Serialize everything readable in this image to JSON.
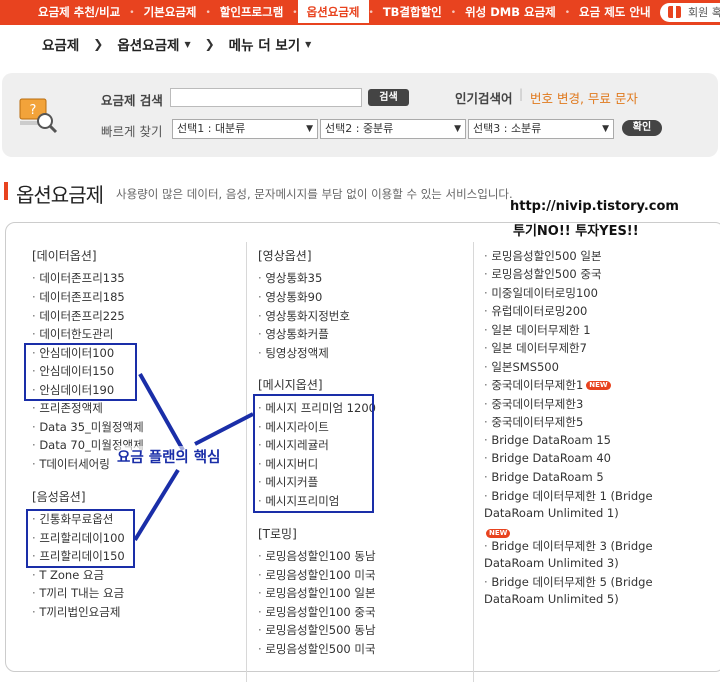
{
  "topnav": {
    "items": [
      "요금제 추천/비교",
      "기본요금제",
      "할인프로그램",
      "옵션요금제",
      "TB결합할인",
      "위성 DMB 요금제",
      "요금 제도 안내"
    ],
    "active_index": 3,
    "member_label": "회원 혹시"
  },
  "breadcrumb": {
    "items": [
      "요금제",
      "옵션요금제",
      "메뉴 더 보기"
    ]
  },
  "search": {
    "label": "요금제 검색",
    "button": "검색",
    "popular_label": "인기검색어",
    "popular_terms": "번호 변경, 무료 문자",
    "quick_label": "빠르게 찾기",
    "select1": "선택1 : 대분류",
    "select2": "선택2 : 중분류",
    "select3": "선택3 : 소분류",
    "confirm_button": "확인"
  },
  "section": {
    "title": "옵션요금제",
    "description": "사용량이 많은 데이터, 음성, 문자메시지를 부담 없이 이용할 수 있는 서비스입니다."
  },
  "overlay": {
    "url": "http://nivip.tistory.com",
    "note": "투기NO!! 투자YES!!",
    "annotation": "요금 플랜의 핵심"
  },
  "columns": {
    "data_options": {
      "title": "[데이터옵션]",
      "items": [
        "데이터존프리135",
        "데이터존프리185",
        "데이터존프리225",
        "데이터한도관리",
        "안심데이터100",
        "안심데이터150",
        "안심데이터190",
        "프리존정액제",
        "Data 35_미월정액제",
        "Data 70_미월정액제",
        "T데이터세어링"
      ]
    },
    "voice_options": {
      "title": "[음성옵션]",
      "items": [
        "긴통화무료옵션",
        "프리할리데이100",
        "프리할리데이150",
        "T Zone 요금",
        "T끼리 T내는 요금",
        "T끼리법인요금제"
      ]
    },
    "video_options": {
      "title": "[영상옵션]",
      "items": [
        "영상통화35",
        "영상통화90",
        "영상통화지정번호",
        "영상통화커플",
        "팅영상정액제"
      ]
    },
    "message_options": {
      "title": "[메시지옵션]",
      "items": [
        "메시지 프리미엄 1200",
        "메시지라이트",
        "메시지레귤러",
        "메시지버디",
        "메시지커플",
        "메시지프리미엄"
      ]
    },
    "roaming": {
      "title": "[T로밍]",
      "items": [
        "로밍음성할인100 동남",
        "로밍음성할인100 미국",
        "로밍음성할인100 일본",
        "로밍음성할인100 중국",
        "로밍음성할인500 동남",
        "로밍음성할인500 미국"
      ]
    },
    "roaming_more": {
      "items": [
        "로밍음성할인500 일본",
        "로밍음성할인500 중국",
        "미중일데이터로밍100",
        "유럽데이터로밍200",
        "일본 데이터무제한 1",
        "일본 데이터무제한7",
        "일본SMS500",
        "중국데이터무제한1",
        "중국데이터무제한3",
        "중국데이터무제한5",
        "Bridge DataRoam 15",
        "Bridge DataRoam 40",
        "Bridge DataRoam 5",
        "Bridge 데이터무제한 1 (Bridge DataRoam Unlimited 1)",
        "Bridge 데이터무제한 3 (Bridge DataRoam Unlimited 3)",
        "Bridge 데이터무제한 5 (Bridge DataRoam Unlimited 5)"
      ],
      "new_badge": "NEW"
    }
  },
  "colors": {
    "accent": "#e8431f",
    "highlight": "#1a2ea8"
  }
}
